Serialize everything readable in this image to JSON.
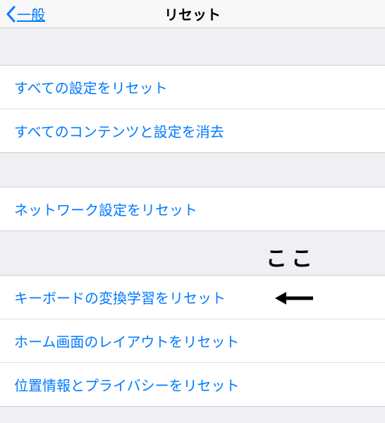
{
  "header": {
    "back_label": "一般",
    "title": "リセット"
  },
  "group1": {
    "items": [
      {
        "label": "すべての設定をリセット"
      },
      {
        "label": "すべてのコンテンツと設定を消去"
      }
    ]
  },
  "group2": {
    "items": [
      {
        "label": "ネットワーク設定をリセット"
      }
    ]
  },
  "group3": {
    "items": [
      {
        "label": "キーボードの変換学習をリセット"
      },
      {
        "label": "ホーム画面のレイアウトをリセット"
      },
      {
        "label": "位置情報とプライバシーをリセット"
      }
    ]
  },
  "annotation": {
    "text": "ここ"
  }
}
